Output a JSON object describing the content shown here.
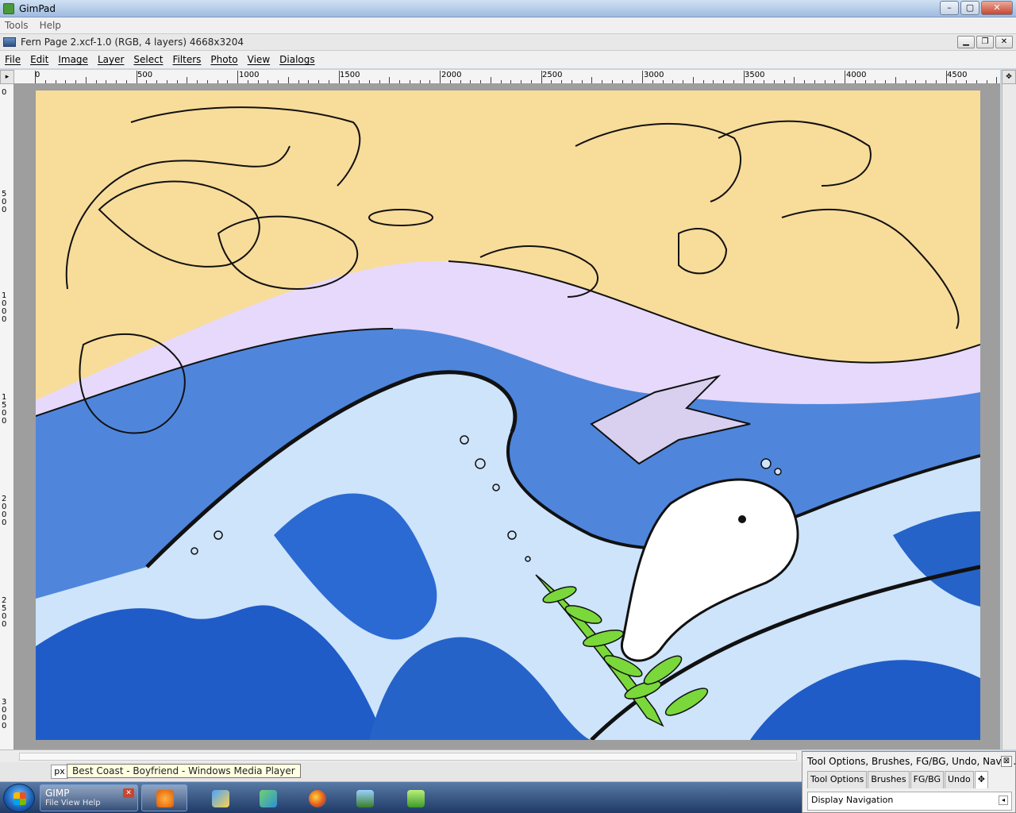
{
  "outer_window": {
    "title": "GimPad",
    "minimize": "–",
    "maximize": "▢",
    "close": "✕"
  },
  "app_menu": [
    "Tools",
    "Help"
  ],
  "document": {
    "title": "Fern Page 2.xcf-1.0 (RGB, 4 layers) 4668x3204",
    "minimize": "▁",
    "restore": "❐",
    "close": "✕"
  },
  "gimp_menu": [
    "File",
    "Edit",
    "Image",
    "Layer",
    "Select",
    "Filters",
    "Photo",
    "View",
    "Dialogs"
  ],
  "ruler": {
    "corner": "▸",
    "h_labels": [
      "0",
      "500",
      "1000",
      "1500",
      "2000",
      "2500",
      "3000",
      "3500",
      "4000",
      "4500"
    ],
    "v_labels": [
      "0",
      "500",
      "1000",
      "1500",
      "2000",
      "2500",
      "3000"
    ]
  },
  "artwork_palette": {
    "sand": "#f8dc9a",
    "lavender": "#e8d8ff",
    "water": "#4a7fd8",
    "deep": "#1f5cc8",
    "foam": "#cde4fb",
    "fern": "#7ad83a",
    "ink": "#111111"
  },
  "status": {
    "unit": "px",
    "tooltip": "Best Coast - Boyfriend - Windows Media Player"
  },
  "taskbar": {
    "gimp_label": "GIMP",
    "gimp_sub": "File  View  Help",
    "gimp_close": "✕"
  },
  "dock": {
    "title": "Tool Options, Brushes, FG/BG, Undo, Navig...",
    "close": "⊠",
    "tabs": [
      "Tool Options",
      "Brushes",
      "FG/BG",
      "Undo",
      "✥"
    ],
    "content": "Display Navigation",
    "menu_arrow": "◂"
  }
}
